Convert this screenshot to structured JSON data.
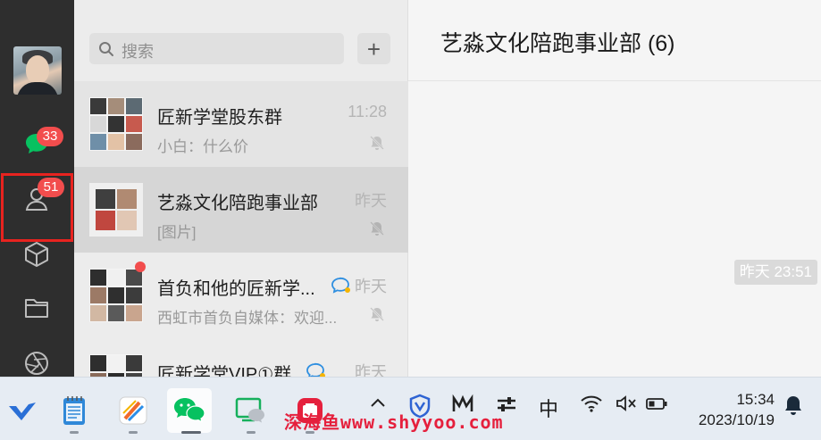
{
  "nav": {
    "chat_badge": "33",
    "contacts_badge": "51"
  },
  "search": {
    "placeholder": "搜索",
    "add_label": "+"
  },
  "chats": [
    {
      "name": "匠新学堂股东群",
      "message": "小白：什么价",
      "time": "11:28",
      "muted": true
    },
    {
      "name": "艺淼文化陪跑事业部",
      "message": "[图片]",
      "time": "昨天",
      "muted": true,
      "selected": true
    },
    {
      "name": "首负和他的匠新学...",
      "message": "西虹市首负自媒体：欢迎...",
      "time": "昨天",
      "muted": true,
      "unread_dot": true,
      "mention_icon": true
    },
    {
      "name": "匠新学堂VIP①群",
      "message": "",
      "time": "昨天",
      "mention_icon": true
    }
  ],
  "conversation": {
    "title": "艺淼文化陪跑事业部 (6)",
    "timestamp": "昨天 23:51"
  },
  "taskbar": {
    "ime": "中",
    "time": "15:34",
    "date": "2023/10/19",
    "watermark": "深海鱼www.shyyoo.com"
  },
  "colors": {
    "badge": "#f24d4d",
    "highlight": "#e8231f",
    "wechat_green": "#07c160"
  }
}
